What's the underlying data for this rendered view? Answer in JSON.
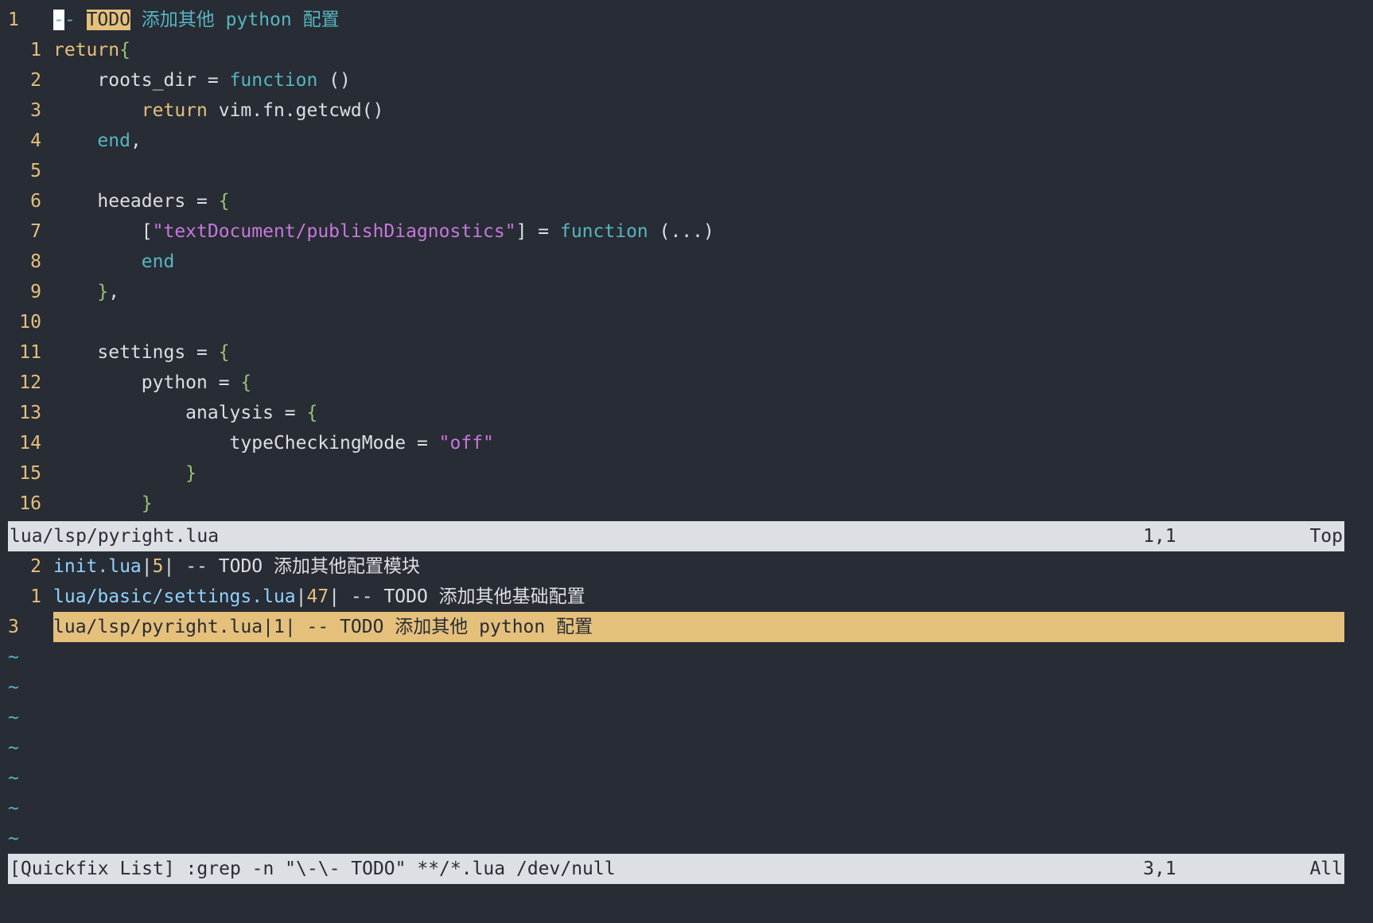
{
  "colors": {
    "background": "#282c34",
    "foreground": "#dcdfe4",
    "line_number": "#e5c07b",
    "keyword": "#e5c07b",
    "function": "#56b6c2",
    "string": "#c678dd",
    "brace": "#98c379",
    "todo_highlight": "#e5c07b",
    "statusline_bg": "#dcdfe4"
  },
  "editor": {
    "header_line": {
      "number": "1",
      "cursor_char": "-",
      "comment_dash": "- ",
      "todo": "TODO",
      "rest": " 添加其他 python 配置"
    },
    "lines": [
      {
        "n": "1",
        "text": "return{"
      },
      {
        "n": "2",
        "text": "    roots_dir = function ()"
      },
      {
        "n": "3",
        "text": "        return vim.fn.getcwd()"
      },
      {
        "n": "4",
        "text": "    end,"
      },
      {
        "n": "5",
        "text": ""
      },
      {
        "n": "6",
        "text": "    heeaders = {"
      },
      {
        "n": "7",
        "text": "        [\"textDocument/publishDiagnostics\"] = function (...)"
      },
      {
        "n": "8",
        "text": "        end"
      },
      {
        "n": "9",
        "text": "    },"
      },
      {
        "n": "10",
        "text": ""
      },
      {
        "n": "11",
        "text": "    settings = {"
      },
      {
        "n": "12",
        "text": "        python = {"
      },
      {
        "n": "13",
        "text": "            analysis = {"
      },
      {
        "n": "14",
        "text": "                typeCheckingMode = \"off\""
      },
      {
        "n": "15",
        "text": "            }"
      },
      {
        "n": "16",
        "text": "        }"
      }
    ],
    "status": {
      "filename": "lua/lsp/pyright.lua",
      "position": "1,1",
      "percent": "Top"
    }
  },
  "quickfix": {
    "entries": [
      {
        "n": "2",
        "file": "init.lua",
        "lnum": "5",
        "text": " -- TODO 添加其他配置模块"
      },
      {
        "n": "1",
        "file": "lua/basic/settings.lua",
        "lnum": "47",
        "text": " -- TODO 添加其他基础配置"
      },
      {
        "n": "3",
        "file": "lua/lsp/pyright.lua",
        "lnum": "1",
        "text": " -- TODO 添加其他 python 配置"
      }
    ],
    "tilde": "~",
    "status": {
      "title": "[Quickfix List] :grep -n \"\\-\\- TODO\" **/*.lua /dev/null",
      "position": "3,1",
      "percent": "All"
    }
  }
}
